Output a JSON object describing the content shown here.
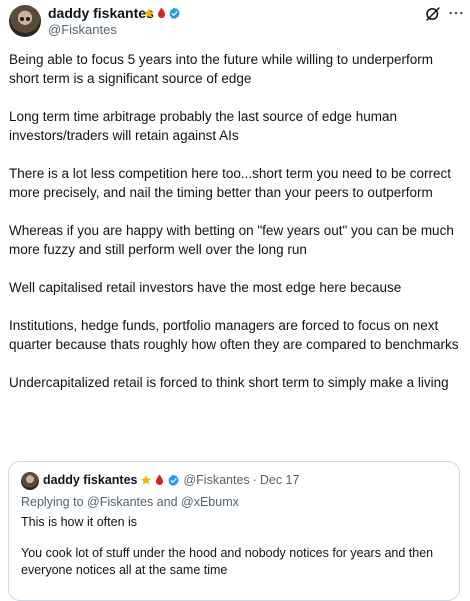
{
  "author": {
    "name": "daddy fiskantes",
    "handle": "@Fiskantes",
    "badges": [
      "star-icon",
      "blood-drop-icon",
      "verified-badge-icon"
    ]
  },
  "header_actions": [
    "grok-icon",
    "more-options-icon"
  ],
  "tweet": {
    "paragraphs": [
      "Being able to focus 5 years into the future while willing to underperform short term is a significant source of edge",
      "Long term time arbitrage probably the last source of edge human investors/traders will retain against AIs",
      "There is a lot less competition here too...short term you need to be correct more precisely, and nail the timing better than your peers to outperform",
      "Whereas if you are happy with betting on \"few years out\" you can be much more fuzzy and still perform well over the long run",
      "Well capitalised retail investors have the most edge here  because",
      "Institutions, hedge funds, portfolio managers are forced to focus on next quarter because thats roughly how often they are compared to benchmarks",
      "Undercapitalized retail is forced to think short term to simply make a living"
    ]
  },
  "quote": {
    "name": "daddy fiskantes",
    "handle": "@Fiskantes",
    "separator": "·",
    "date": "Dec 17",
    "replying_prefix": "Replying to ",
    "replying_user1": "@Fiskantes",
    "replying_and": " and ",
    "replying_user2": "@xEbumx",
    "paragraphs": [
      "This is how it often is",
      "You cook lot of stuff under the hood and nobody notices for years and then everyone notices all at the same time"
    ]
  },
  "colors": {
    "text": "#0f1419",
    "secondary": "#536471",
    "verified": "#1d9bf0",
    "star": "#f4b400",
    "drop": "#d6202d",
    "border": "#cfd9de"
  }
}
